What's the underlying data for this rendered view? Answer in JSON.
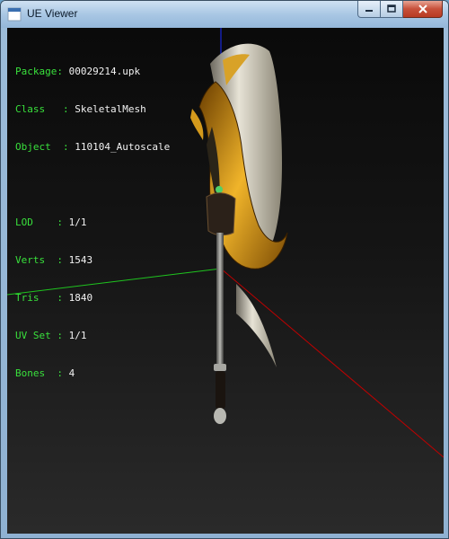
{
  "window": {
    "title": "UE Viewer"
  },
  "info": {
    "package": {
      "label": "Package: ",
      "value": "00029214.upk"
    },
    "class": {
      "label": "Class   : ",
      "value": "SkeletalMesh"
    },
    "object": {
      "label": "Object  : ",
      "value": "110104_Autoscale"
    },
    "lod": {
      "label": "LOD    : ",
      "value": "1/1"
    },
    "verts": {
      "label": "Verts  : ",
      "value": "1543"
    },
    "tris": {
      "label": "Tris   : ",
      "value": "1840"
    },
    "uvset": {
      "label": "UV Set : ",
      "value": "1/1"
    },
    "bones": {
      "label": "Bones  : ",
      "value": "4"
    }
  },
  "colors": {
    "label_text": "#39e03c",
    "value_text": "#f2f2f2",
    "axis_x": "#c00000",
    "axis_y": "#1fc41f",
    "axis_z": "#1a2cff",
    "blade_gold": "#c98a0e",
    "blade_silver": "#c9c4b4"
  },
  "icons": {
    "app": "ue-viewer-app-icon",
    "minimize": "minimize-icon",
    "maximize": "maximize-icon",
    "close": "close-icon"
  }
}
